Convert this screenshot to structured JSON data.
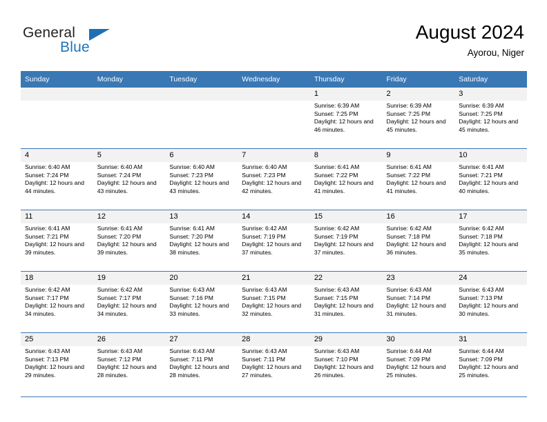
{
  "brand": {
    "name_part1": "General",
    "name_part2": "Blue",
    "logo_icon": "triangle-logo-icon"
  },
  "header": {
    "title": "August 2024",
    "subtitle": "Ayorou, Niger"
  },
  "colors": {
    "header_blue": "#3978b4",
    "daynum_band": "#f2f2f2",
    "brand_blue": "#1b74bb",
    "text": "#000000"
  },
  "calendar": {
    "weekday_headers": [
      "Sunday",
      "Monday",
      "Tuesday",
      "Wednesday",
      "Thursday",
      "Friday",
      "Saturday"
    ],
    "weeks": [
      [
        {
          "day": "",
          "empty": true
        },
        {
          "day": "",
          "empty": true
        },
        {
          "day": "",
          "empty": true
        },
        {
          "day": "",
          "empty": true
        },
        {
          "day": "1",
          "sunrise": "Sunrise: 6:39 AM",
          "sunset": "Sunset: 7:25 PM",
          "daylight": "Daylight: 12 hours and 46 minutes."
        },
        {
          "day": "2",
          "sunrise": "Sunrise: 6:39 AM",
          "sunset": "Sunset: 7:25 PM",
          "daylight": "Daylight: 12 hours and 45 minutes."
        },
        {
          "day": "3",
          "sunrise": "Sunrise: 6:39 AM",
          "sunset": "Sunset: 7:25 PM",
          "daylight": "Daylight: 12 hours and 45 minutes."
        }
      ],
      [
        {
          "day": "4",
          "sunrise": "Sunrise: 6:40 AM",
          "sunset": "Sunset: 7:24 PM",
          "daylight": "Daylight: 12 hours and 44 minutes."
        },
        {
          "day": "5",
          "sunrise": "Sunrise: 6:40 AM",
          "sunset": "Sunset: 7:24 PM",
          "daylight": "Daylight: 12 hours and 43 minutes."
        },
        {
          "day": "6",
          "sunrise": "Sunrise: 6:40 AM",
          "sunset": "Sunset: 7:23 PM",
          "daylight": "Daylight: 12 hours and 43 minutes."
        },
        {
          "day": "7",
          "sunrise": "Sunrise: 6:40 AM",
          "sunset": "Sunset: 7:23 PM",
          "daylight": "Daylight: 12 hours and 42 minutes."
        },
        {
          "day": "8",
          "sunrise": "Sunrise: 6:41 AM",
          "sunset": "Sunset: 7:22 PM",
          "daylight": "Daylight: 12 hours and 41 minutes."
        },
        {
          "day": "9",
          "sunrise": "Sunrise: 6:41 AM",
          "sunset": "Sunset: 7:22 PM",
          "daylight": "Daylight: 12 hours and 41 minutes."
        },
        {
          "day": "10",
          "sunrise": "Sunrise: 6:41 AM",
          "sunset": "Sunset: 7:21 PM",
          "daylight": "Daylight: 12 hours and 40 minutes."
        }
      ],
      [
        {
          "day": "11",
          "sunrise": "Sunrise: 6:41 AM",
          "sunset": "Sunset: 7:21 PM",
          "daylight": "Daylight: 12 hours and 39 minutes."
        },
        {
          "day": "12",
          "sunrise": "Sunrise: 6:41 AM",
          "sunset": "Sunset: 7:20 PM",
          "daylight": "Daylight: 12 hours and 39 minutes."
        },
        {
          "day": "13",
          "sunrise": "Sunrise: 6:41 AM",
          "sunset": "Sunset: 7:20 PM",
          "daylight": "Daylight: 12 hours and 38 minutes."
        },
        {
          "day": "14",
          "sunrise": "Sunrise: 6:42 AM",
          "sunset": "Sunset: 7:19 PM",
          "daylight": "Daylight: 12 hours and 37 minutes."
        },
        {
          "day": "15",
          "sunrise": "Sunrise: 6:42 AM",
          "sunset": "Sunset: 7:19 PM",
          "daylight": "Daylight: 12 hours and 37 minutes."
        },
        {
          "day": "16",
          "sunrise": "Sunrise: 6:42 AM",
          "sunset": "Sunset: 7:18 PM",
          "daylight": "Daylight: 12 hours and 36 minutes."
        },
        {
          "day": "17",
          "sunrise": "Sunrise: 6:42 AM",
          "sunset": "Sunset: 7:18 PM",
          "daylight": "Daylight: 12 hours and 35 minutes."
        }
      ],
      [
        {
          "day": "18",
          "sunrise": "Sunrise: 6:42 AM",
          "sunset": "Sunset: 7:17 PM",
          "daylight": "Daylight: 12 hours and 34 minutes."
        },
        {
          "day": "19",
          "sunrise": "Sunrise: 6:42 AM",
          "sunset": "Sunset: 7:17 PM",
          "daylight": "Daylight: 12 hours and 34 minutes."
        },
        {
          "day": "20",
          "sunrise": "Sunrise: 6:43 AM",
          "sunset": "Sunset: 7:16 PM",
          "daylight": "Daylight: 12 hours and 33 minutes."
        },
        {
          "day": "21",
          "sunrise": "Sunrise: 6:43 AM",
          "sunset": "Sunset: 7:15 PM",
          "daylight": "Daylight: 12 hours and 32 minutes."
        },
        {
          "day": "22",
          "sunrise": "Sunrise: 6:43 AM",
          "sunset": "Sunset: 7:15 PM",
          "daylight": "Daylight: 12 hours and 31 minutes."
        },
        {
          "day": "23",
          "sunrise": "Sunrise: 6:43 AM",
          "sunset": "Sunset: 7:14 PM",
          "daylight": "Daylight: 12 hours and 31 minutes."
        },
        {
          "day": "24",
          "sunrise": "Sunrise: 6:43 AM",
          "sunset": "Sunset: 7:13 PM",
          "daylight": "Daylight: 12 hours and 30 minutes."
        }
      ],
      [
        {
          "day": "25",
          "sunrise": "Sunrise: 6:43 AM",
          "sunset": "Sunset: 7:13 PM",
          "daylight": "Daylight: 12 hours and 29 minutes."
        },
        {
          "day": "26",
          "sunrise": "Sunrise: 6:43 AM",
          "sunset": "Sunset: 7:12 PM",
          "daylight": "Daylight: 12 hours and 28 minutes."
        },
        {
          "day": "27",
          "sunrise": "Sunrise: 6:43 AM",
          "sunset": "Sunset: 7:11 PM",
          "daylight": "Daylight: 12 hours and 28 minutes."
        },
        {
          "day": "28",
          "sunrise": "Sunrise: 6:43 AM",
          "sunset": "Sunset: 7:11 PM",
          "daylight": "Daylight: 12 hours and 27 minutes."
        },
        {
          "day": "29",
          "sunrise": "Sunrise: 6:43 AM",
          "sunset": "Sunset: 7:10 PM",
          "daylight": "Daylight: 12 hours and 26 minutes."
        },
        {
          "day": "30",
          "sunrise": "Sunrise: 6:44 AM",
          "sunset": "Sunset: 7:09 PM",
          "daylight": "Daylight: 12 hours and 25 minutes."
        },
        {
          "day": "31",
          "sunrise": "Sunrise: 6:44 AM",
          "sunset": "Sunset: 7:09 PM",
          "daylight": "Daylight: 12 hours and 25 minutes."
        }
      ]
    ]
  }
}
